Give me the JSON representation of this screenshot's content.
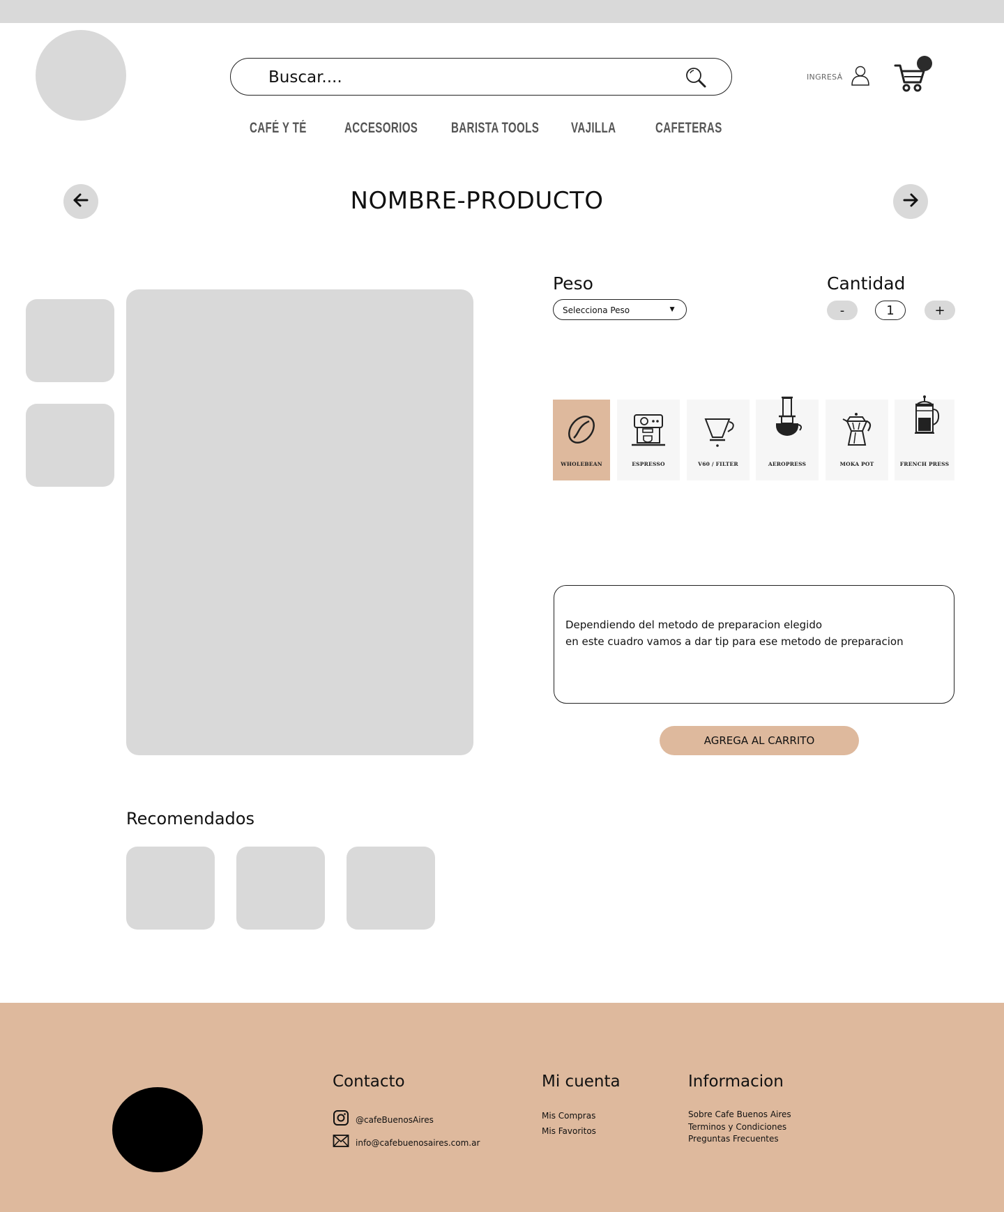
{
  "header": {
    "search": {
      "placeholder": "Buscar...."
    },
    "login_label": "INGRESÁ",
    "nav": [
      {
        "label": "CAFÉ Y TÉ"
      },
      {
        "label": "ACCESORIOS"
      },
      {
        "label": "BARISTA TOOLS"
      },
      {
        "label": "VAJILLA"
      },
      {
        "label": "CAFETERAS"
      }
    ]
  },
  "product": {
    "title": "NOMBRE-PRODUCTO",
    "peso_label": "Peso",
    "peso_select": "Selecciona Peso",
    "cantidad_label": "Cantidad",
    "minus": "-",
    "quantity": "1",
    "plus": "+",
    "methods": [
      {
        "label": "WHOLEBEAN",
        "icon": "coffee-bean-icon",
        "selected": true
      },
      {
        "label": "ESPRESSO",
        "icon": "espresso-machine-icon",
        "selected": false
      },
      {
        "label": "V60 / FILTER",
        "icon": "pour-over-icon",
        "selected": false
      },
      {
        "label": "AEROPRESS",
        "icon": "aeropress-icon",
        "selected": false
      },
      {
        "label": "MOKA POT",
        "icon": "moka-pot-icon",
        "selected": false
      },
      {
        "label": "FRENCH PRESS",
        "icon": "french-press-icon",
        "selected": false
      }
    ],
    "tip": "Dependiendo del metodo de preparacion elegido\nen este cuadro vamos a dar tip para ese metodo de preparacion",
    "add_to_cart": "AGREGA AL CARRITO"
  },
  "recomendados": {
    "title": "Recomendados"
  },
  "footer": {
    "contacto": {
      "title": "Contacto",
      "instagram": "@cafeBuenosAires",
      "email": "info@cafebuenosaires.com.ar"
    },
    "mi_cuenta": {
      "title": "Mi cuenta",
      "links": [
        "Mis Compras",
        "Mis Favoritos"
      ]
    },
    "informacion": {
      "title": "Informacion",
      "links": [
        "Sobre Cafe Buenos Aires",
        "Terminos y Condiciones",
        "Preguntas Frecuentes"
      ]
    }
  },
  "colors": {
    "accent": "#deb99d",
    "placeholder_gray": "#d9d9d9",
    "method_bg": "#f6f6f6"
  }
}
